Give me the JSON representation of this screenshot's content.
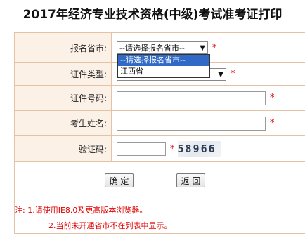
{
  "page": {
    "title": "2017年经济专业技术资格(中级)考试准考证打印"
  },
  "form": {
    "province": {
      "label": "报名省市:",
      "selected": "--请选择报名省市--",
      "required_mark": "*",
      "options": [
        "--请选择报名省市--",
        "江西省"
      ]
    },
    "id_type": {
      "label": "证件类型:",
      "required_mark": "*"
    },
    "id_number": {
      "label": "证件号码:",
      "value": "",
      "required_mark": "*"
    },
    "name": {
      "label": "考生姓名:",
      "value": "",
      "required_mark": "*"
    },
    "captcha": {
      "label": "验证码:",
      "value": "",
      "required_mark": "*",
      "image_text": "58966"
    }
  },
  "buttons": {
    "confirm": "确 定",
    "back": "返 回"
  },
  "notes": {
    "line1": "注: 1.请使用IE8.0及更高版本浏览器。",
    "line2": "2.当前未开通省市不在列表中显示。"
  }
}
